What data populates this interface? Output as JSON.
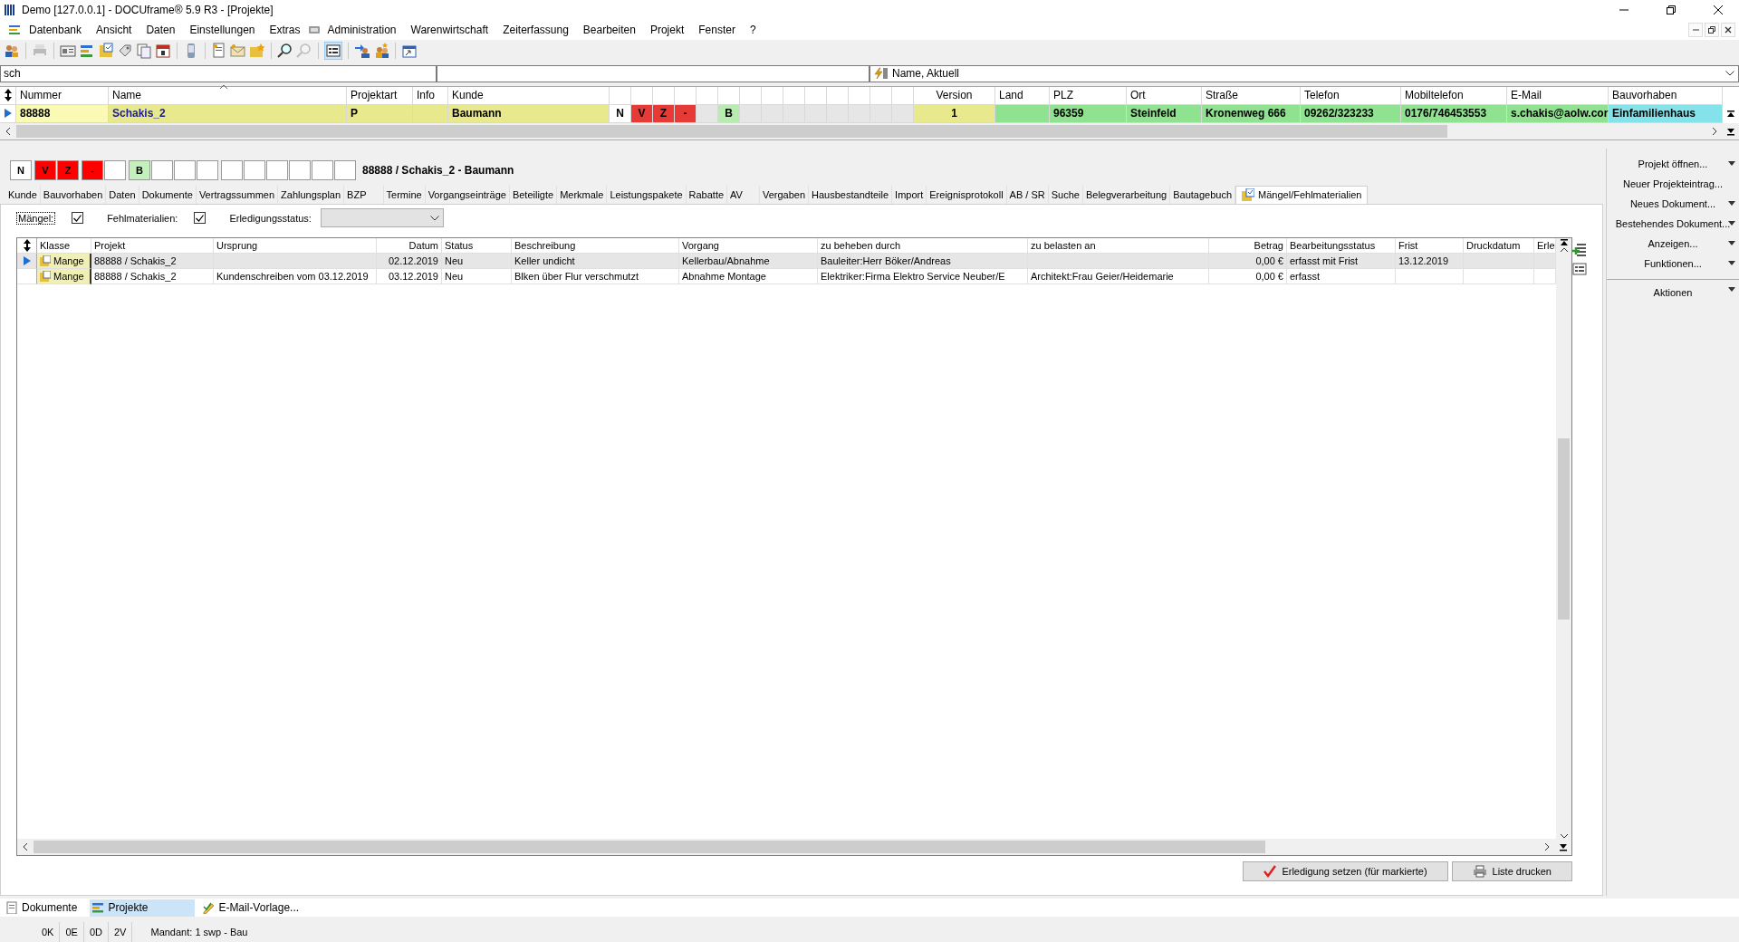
{
  "window": {
    "title": "Demo [127.0.0.1] - DOCUframe® 5.9 R3 - [Projekte]"
  },
  "menu": [
    "Datenbank",
    "Ansicht",
    "Daten",
    "Einstellungen",
    "Extras",
    "Administration",
    "Warenwirtschaft",
    "Zeiterfassung",
    "Bearbeiten",
    "Projekt",
    "Fenster",
    "?"
  ],
  "search": {
    "value": "sch",
    "view": "Name, Aktuell"
  },
  "top_grid": {
    "columns_left": [
      "Nummer",
      "Name",
      "Projektart",
      "Info",
      "Kunde"
    ],
    "columns_right": [
      "Version",
      "Land",
      "PLZ",
      "Ort",
      "Straße",
      "Telefon",
      "Mobiltelefon",
      "E-Mail",
      "Bauvorhaben"
    ],
    "row": {
      "selected": true,
      "cells_left": [
        {
          "text": "88888",
          "color": "#fafab4"
        },
        {
          "text": "Schakis_2",
          "color": "#e8e88c"
        },
        {
          "text": "P",
          "color": "#e8e88c"
        },
        {
          "color": "#e8e88c"
        },
        {
          "text": "Baumann",
          "color": "#e8e88c"
        }
      ],
      "flags": [
        {
          "text": "N",
          "color": "#ffffff"
        },
        {
          "text": "V",
          "color": "#e53a35"
        },
        {
          "text": "Z",
          "color": "#e53a35"
        },
        {
          "text": "-",
          "color": "#e53a35"
        },
        {
          "color": "#e6e6e6"
        },
        {
          "text": "B",
          "color": "#b8ebb0"
        },
        {
          "color": "#e6e6e6"
        },
        {
          "color": "#e6e6e6"
        },
        {
          "color": "#e6e6e6"
        },
        {
          "color": "#e6e6e6"
        },
        {
          "color": "#e6e6e6"
        },
        {
          "color": "#e6e6e6"
        },
        {
          "color": "#e6e6e6"
        },
        {
          "color": "#e6e6e6"
        }
      ],
      "cells_right": [
        {
          "text": "1",
          "color": "#e8e88c"
        },
        {
          "color": "#8fe28f"
        },
        {
          "text": "96359",
          "color": "#8fe28f"
        },
        {
          "text": "Steinfeld",
          "color": "#8fe28f"
        },
        {
          "text": "Kronenweg 666",
          "color": "#8fe28f"
        },
        {
          "text": "09262/323233",
          "color": "#8fe28f"
        },
        {
          "text": "0176/746453553",
          "color": "#8fe28f"
        },
        {
          "text": "s.chakis@aolw.cor",
          "color": "#8fe28f"
        },
        {
          "text": "Einfamilienhaus",
          "color": "#84e2ea"
        }
      ]
    }
  },
  "detail": {
    "flag_groups": [
      [
        {
          "text": "N",
          "color": "#ffffff"
        }
      ],
      [
        {
          "text": "V",
          "color": "#ff0000"
        },
        {
          "text": "Z",
          "color": "#ff0000"
        }
      ],
      [
        {
          "text": "-",
          "color": "#ff0000"
        },
        {
          "color": "#ffffff"
        }
      ],
      [
        {
          "text": "B",
          "color": "#c4f0bc"
        },
        {
          "color": "#ffffff"
        },
        {
          "color": "#ffffff"
        },
        {
          "color": "#ffffff"
        }
      ],
      [
        {
          "color": "#ffffff"
        },
        {
          "color": "#ffffff"
        },
        {
          "color": "#ffffff"
        },
        {
          "color": "#ffffff"
        },
        {
          "color": "#ffffff"
        },
        {
          "color": "#ffffff"
        }
      ]
    ],
    "heading": "88888 / Schakis_2 - Baumann",
    "tabs": [
      {
        "label": "Kunde",
        "selected": false
      },
      {
        "label": "Bauvorhaben",
        "selected": false
      },
      {
        "label": "Daten",
        "selected": false
      },
      {
        "label": "Dokumente",
        "selected": false
      },
      {
        "label": "Vertragssummen",
        "selected": false
      },
      {
        "label": "Zahlungsplan",
        "selected": false
      },
      {
        "label": "BZP",
        "selected": false
      },
      {
        "label": "Termine",
        "selected": false
      },
      {
        "label": "Vorgangseinträge",
        "selected": false
      },
      {
        "label": "Beteiligte",
        "selected": false
      },
      {
        "label": "Merkmale",
        "selected": false
      },
      {
        "label": "Leistungspakete",
        "selected": false
      },
      {
        "label": "Rabatte",
        "selected": false
      },
      {
        "label": "AV",
        "selected": false
      },
      {
        "label": "Vergaben",
        "selected": false
      },
      {
        "label": "Hausbestandteile",
        "selected": false
      },
      {
        "label": "Import",
        "selected": false
      },
      {
        "label": "Ereignisprotokoll",
        "selected": false
      },
      {
        "label": "AB / SR",
        "selected": false
      },
      {
        "label": "Suche",
        "selected": false
      },
      {
        "label": "Belegverarbeitung",
        "selected": false
      },
      {
        "label": "Bautagebuch",
        "selected": false
      },
      {
        "label": "Mängel/Fehlmaterialien",
        "selected": true
      }
    ],
    "filters": [
      {
        "label": "Mängel:",
        "checked": true
      },
      {
        "label": "Fehlmaterialien:",
        "checked": true
      }
    ],
    "status_filter": {
      "label": "Erledigungsstatus:"
    },
    "table": {
      "columns": [
        "Klasse",
        "Projekt",
        "Ursprung",
        "Datum",
        "Status",
        "Beschreibung",
        "Vorgang",
        "zu beheben durch",
        "zu belasten an",
        "Betrag",
        "Bearbeitungsstatus",
        "Frist",
        "Druckdatum",
        "Erle"
      ],
      "rows": [
        {
          "selected": true,
          "cells": [
            "Mange",
            "88888 / Schakis_2",
            null,
            "02.12.2019",
            "Neu",
            "Keller undicht",
            "Kellerbau/Abnahme",
            "Bauleiter:Herr Böker/Andreas",
            null,
            "0,00 €",
            "erfasst mit Frist",
            "13.12.2019",
            null,
            null
          ]
        },
        {
          "selected": false,
          "cells": [
            "Mange",
            "88888 / Schakis_2",
            "Kundenschreiben vom 03.12.2019",
            "03.12.2019",
            "Neu",
            "Blken über Flur verschmutzt",
            "Abnahme Montage",
            "Elektriker:Firma Elektro Service Neuber/E",
            "Architekt:Frau Geier/Heidemarie",
            "0,00 €",
            "erfasst",
            null,
            null,
            null
          ]
        }
      ]
    },
    "buttons": [
      "Erledigung setzen (für markierte)",
      "Liste drucken"
    ]
  },
  "actions": [
    {
      "label": "Projekt öffnen...",
      "kind": "dropdown"
    },
    {
      "label": "Neuer Projekteintrag...",
      "kind": "command"
    },
    {
      "label": "Neues Dokument...",
      "kind": "dropdown"
    },
    {
      "label": "Bestehendes Dokument...",
      "kind": "dropdown"
    },
    {
      "label": "Anzeigen...",
      "kind": "dropdown"
    },
    {
      "label": "Funktionen...",
      "kind": "dropdown"
    },
    {
      "label": "Aktionen",
      "kind": "header"
    }
  ],
  "bottom_tabs": [
    {
      "label": "Dokumente",
      "selected": false
    },
    {
      "label": "Projekte",
      "selected": true
    },
    {
      "label": "E-Mail-Vorlage...",
      "selected": false
    }
  ],
  "status_bar": [
    "0K",
    "0E",
    "0D",
    "2V",
    "Mandant: 1 swp - Bau"
  ]
}
